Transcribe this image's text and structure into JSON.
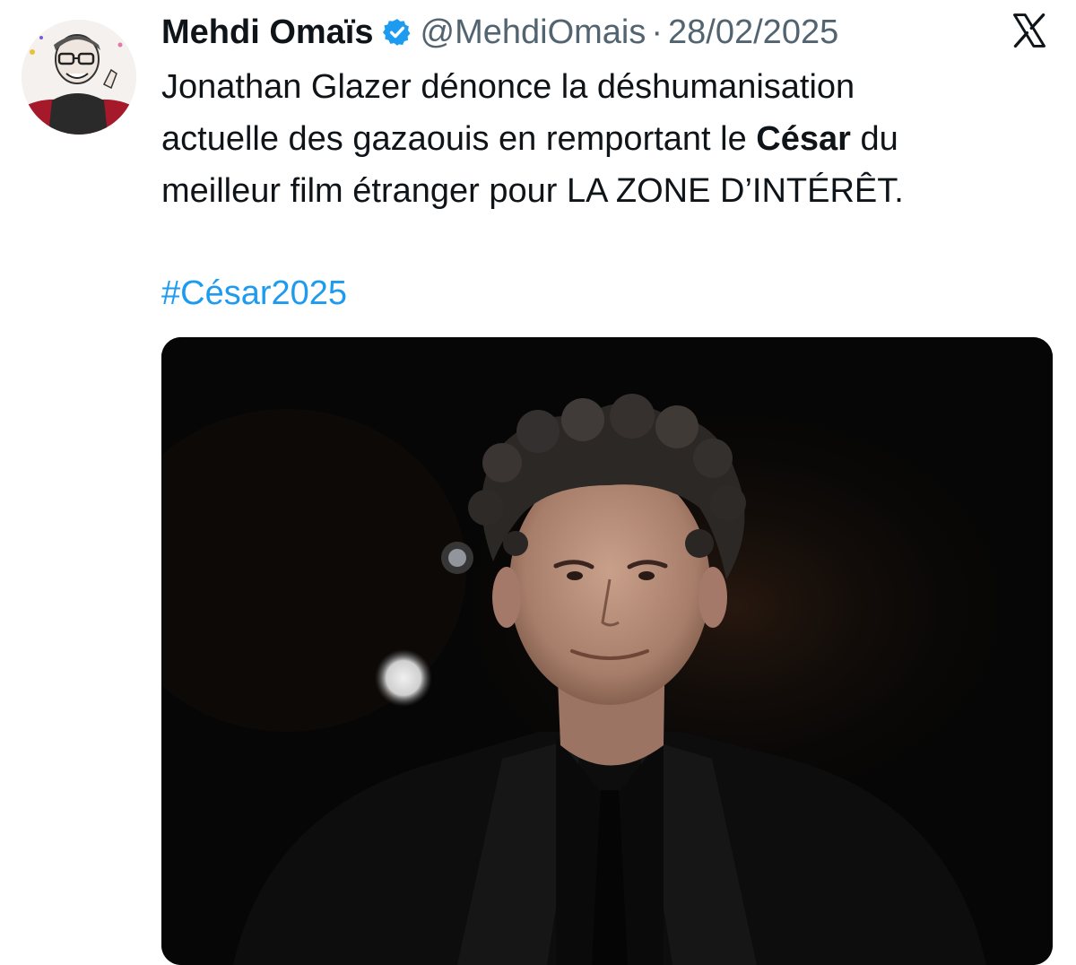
{
  "tweet": {
    "author_name": "Mehdi Omaïs",
    "handle": "@MehdiOmais",
    "separator": "·",
    "date": "28/02/2025",
    "text_lines": {
      "l1": "Jonathan Glazer dénonce la déshumanisation",
      "l2_before": "actuelle des gazaouis en remportant le ",
      "l2_bold": "César",
      "l2_after": " du",
      "l3": "meilleur film étranger pour LA ZONE D’INTÉRÊT."
    },
    "hashtag": "#César2025"
  },
  "icons": {
    "verified": "verified-badge-icon",
    "platform": "x-logo-icon"
  },
  "colors": {
    "link": "#1d9bf0",
    "secondary_text": "#536471",
    "verified": "#1d9bf0",
    "media_background": "#060606"
  }
}
